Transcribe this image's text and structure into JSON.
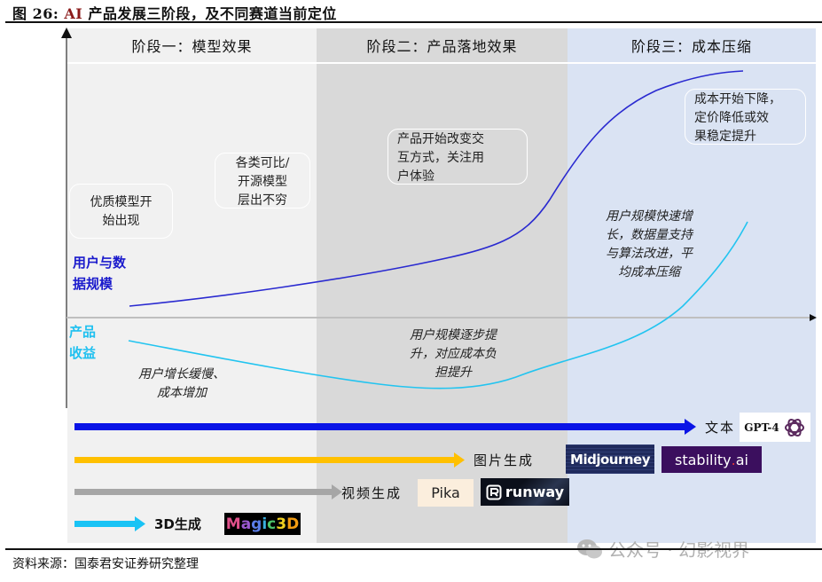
{
  "figure": {
    "title_prefix": "图 26:",
    "title_ai": "AI",
    "title_rest": "产品发展三阶段，及不同赛道当前定位",
    "source": "资料来源：国泰君安证券研究整理",
    "watermark": "公众号 · 幻影视界"
  },
  "stages": [
    {
      "label": "阶段一：模型效果",
      "color": "#f1f1f1"
    },
    {
      "label": "阶段二：产品落地效果",
      "color": "#d9d9d9"
    },
    {
      "label": "阶段三：成本压缩",
      "color": "#dae3f3"
    }
  ],
  "axis_labels": {
    "user_data": "用户与数据规模",
    "user_data_line1": "用户与数",
    "user_data_line2": "据规模",
    "revenue_line1": "产品",
    "revenue_line2": "收益"
  },
  "notes": {
    "stage1_box1": [
      "优质模型开",
      "始出现"
    ],
    "stage1_box2": [
      "各类可比/",
      "开源模型",
      "层出不穷"
    ],
    "stage2_box": [
      "产品开始改变交",
      "互方式，关注用",
      "户体验"
    ],
    "stage3_box": [
      "成本开始下降，",
      "定价降低或效",
      "果稳定提升"
    ],
    "stage1_italic": [
      "用户增长缓慢、",
      "成本增加"
    ],
    "stage2_italic": [
      "用户规模逐步提",
      "升，对应成本负",
      "担提升"
    ],
    "stage3_italic": [
      "用户规模快速增",
      "长，数据量支持",
      "与算法改进，平",
      "均成本压缩"
    ]
  },
  "curves": {
    "user_data_color": "#2a2ad0",
    "revenue_color": "#22c4f0"
  },
  "tracks": [
    {
      "label": "文本",
      "color": "#0a14e6",
      "logos": [
        "GPT-4"
      ]
    },
    {
      "label": "图片生成",
      "color": "#ffc000",
      "logos": [
        "Midjourney",
        "stability.ai"
      ]
    },
    {
      "label": "视频生成",
      "color": "#a6a6a6",
      "logos": [
        "Pika",
        "runway"
      ]
    },
    {
      "label": "3D生成",
      "color": "#19c3f5",
      "logos": [
        "Magic3D"
      ]
    }
  ],
  "logos": {
    "gpt": "GPT-4",
    "midjourney": "Midjourney",
    "stability_main": "stability",
    "stability_dot": ".",
    "stability_end": "ai",
    "pika": "Pika",
    "runway": "runway",
    "magic3d": [
      "M",
      "a",
      "g",
      "i",
      "c",
      "3",
      "D"
    ]
  }
}
